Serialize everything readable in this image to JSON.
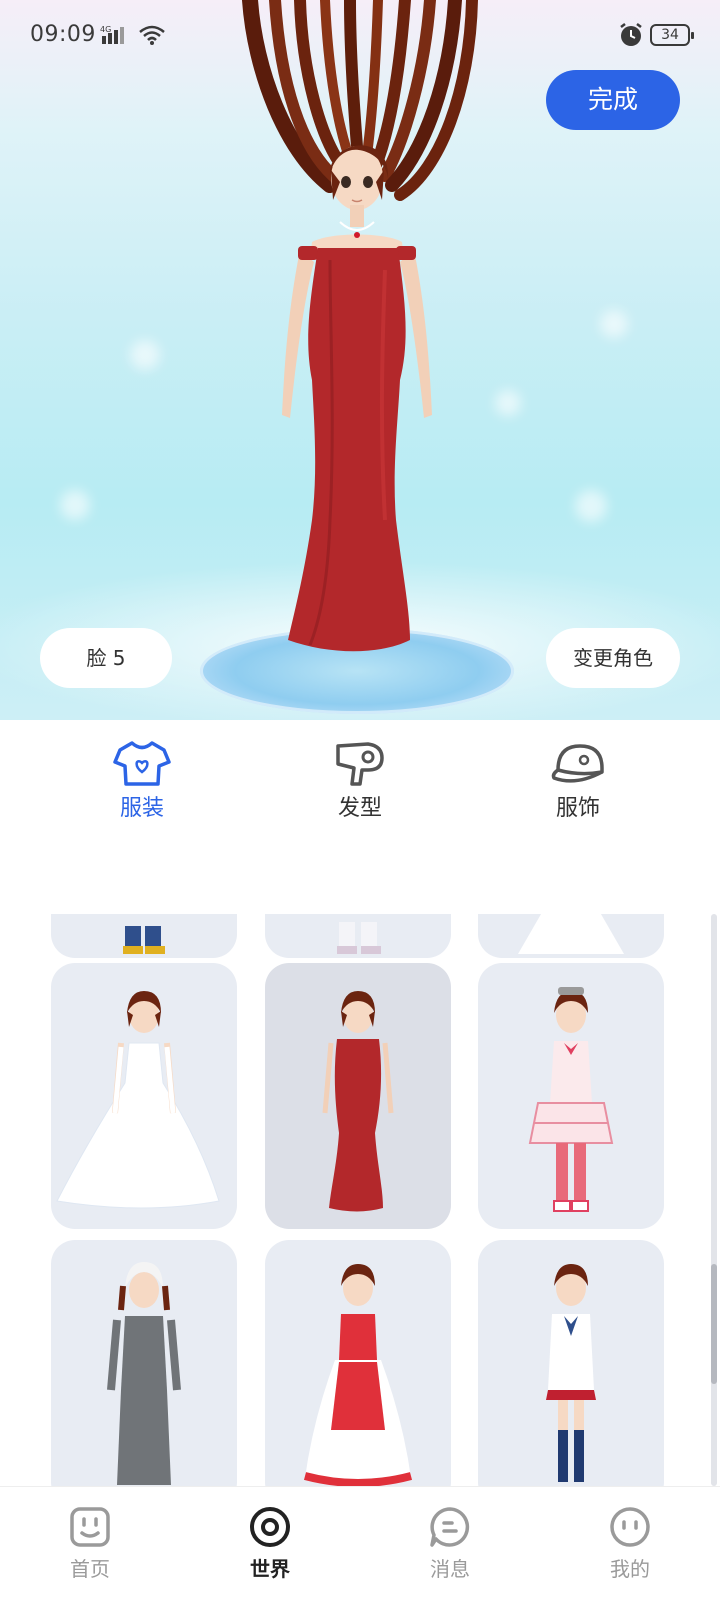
{
  "status_bar": {
    "time": "09:09",
    "network": "4G",
    "battery": "34"
  },
  "preview": {
    "done_label": "完成",
    "face_label": "脸 5",
    "change_role_label": "变更角色",
    "accent_color": "#2c64e6"
  },
  "categories": [
    {
      "label": "服装",
      "icon": "tshirt-icon",
      "active": true
    },
    {
      "label": "发型",
      "icon": "hair-dryer-icon",
      "active": false
    },
    {
      "label": "服饰",
      "icon": "cap-icon",
      "active": false
    }
  ],
  "outfits": [
    {
      "name": "casual",
      "row": 0,
      "selected": false
    },
    {
      "name": "white-pants",
      "row": 0,
      "selected": false
    },
    {
      "name": "white-dress",
      "row": 0,
      "selected": false
    },
    {
      "name": "white-wedding-gown",
      "row": 1,
      "selected": false
    },
    {
      "name": "red-evening-gown",
      "row": 1,
      "selected": true
    },
    {
      "name": "pink-lolita-dress",
      "row": 1,
      "selected": false
    },
    {
      "name": "gray-nun-dress",
      "row": 2,
      "selected": false
    },
    {
      "name": "red-white-ball-gown",
      "row": 2,
      "selected": false
    },
    {
      "name": "school-uniform",
      "row": 2,
      "selected": false
    }
  ],
  "bottom_nav": [
    {
      "label": "首页",
      "icon": "home-face-icon",
      "active": false
    },
    {
      "label": "世界",
      "icon": "world-circle-icon",
      "active": true
    },
    {
      "label": "消息",
      "icon": "message-bubble-icon",
      "active": false
    },
    {
      "label": "我的",
      "icon": "profile-face-icon",
      "active": false
    }
  ]
}
